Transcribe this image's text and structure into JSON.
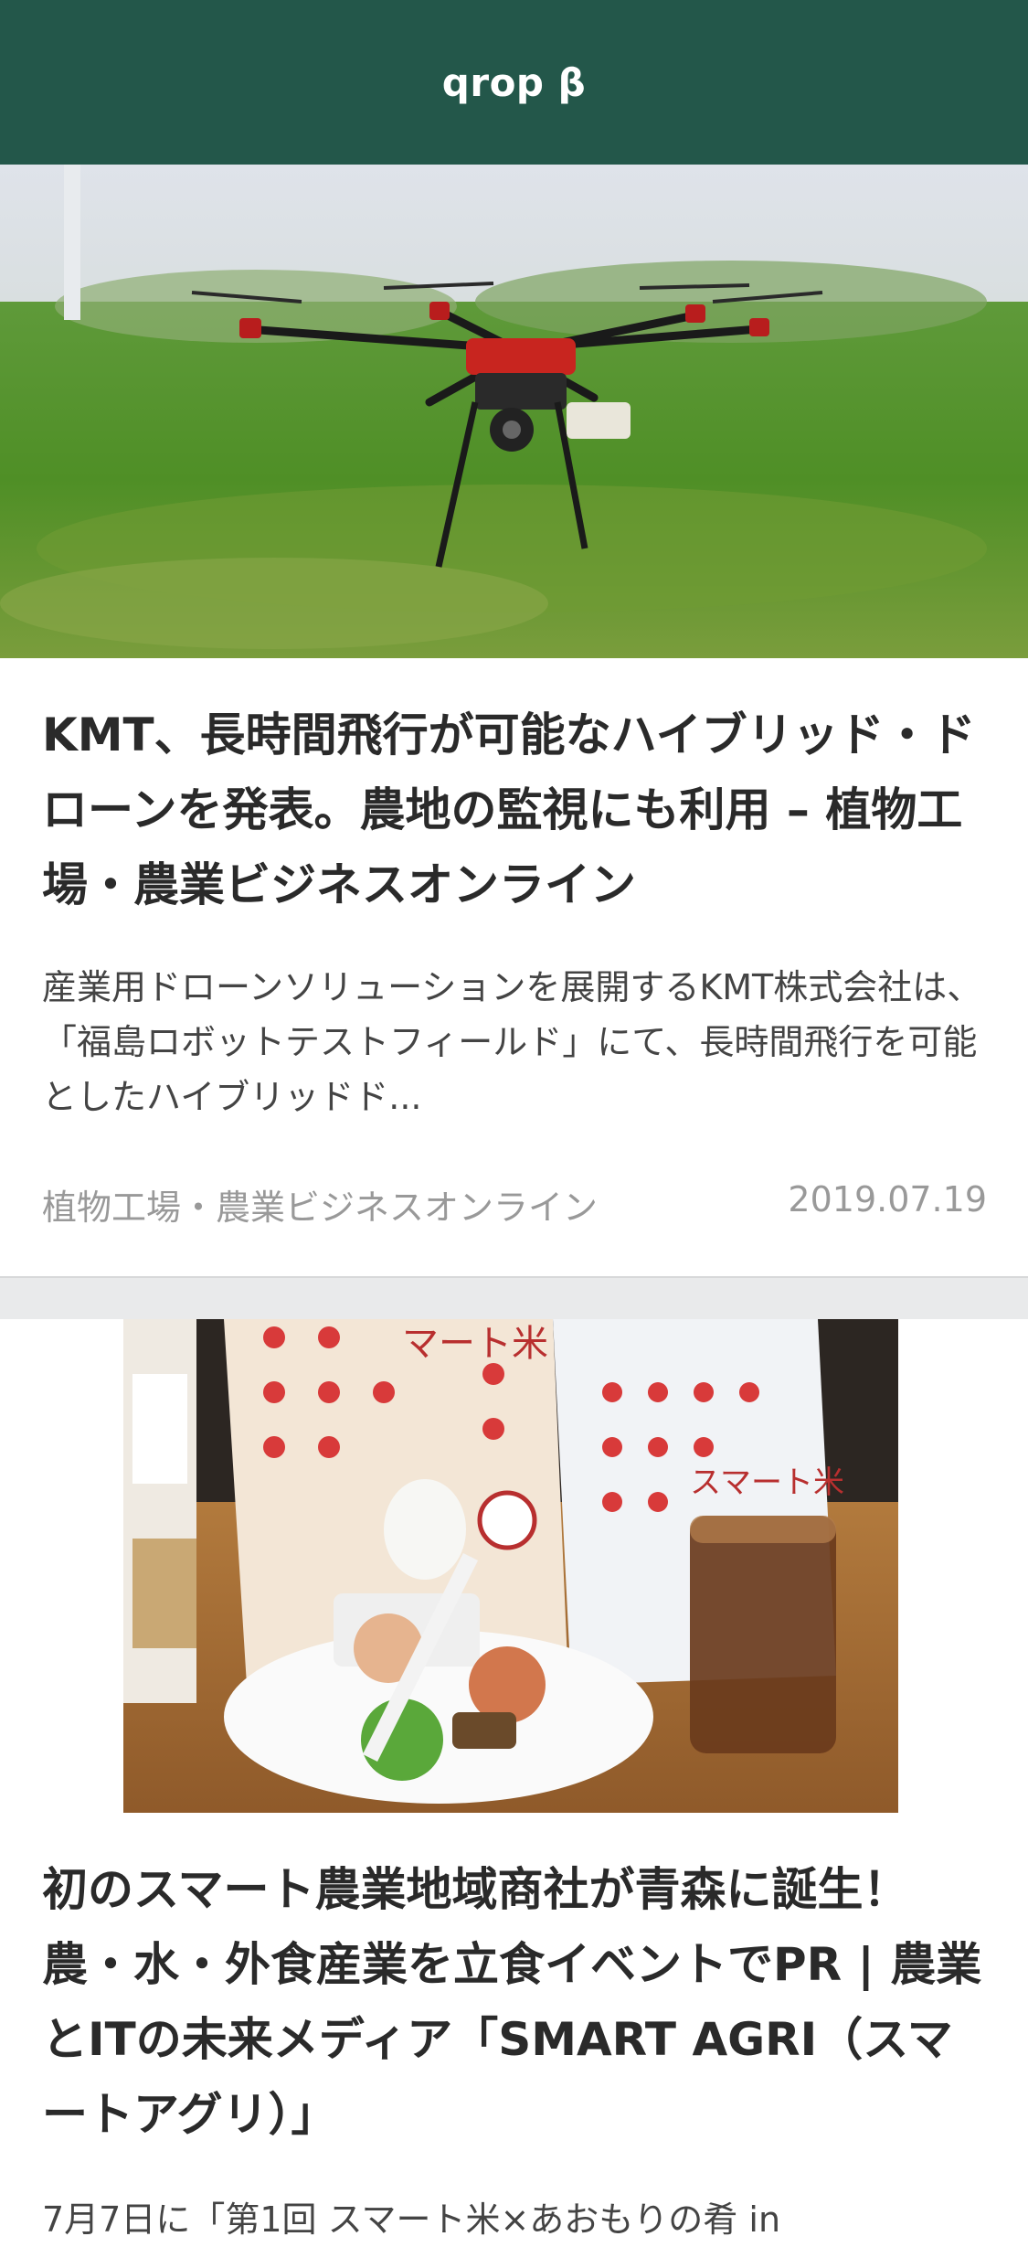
{
  "header": {
    "title": "qrop β"
  },
  "feed": [
    {
      "image_icon": "drone-photo",
      "title": "KMT、長時間飛行が可能なハイブリッド・ドローンを発表。農地の監視にも利用 – 植物工場・農業ビジネスオンライン",
      "summary": "産業用ドローンソリューションを展開するKMT株式会社は、「福島ロボットテストフィールド」にて、長時間飛行を可能としたハイブリッドド...",
      "source": "植物工場・農業ビジネスオンライン",
      "date": "2019.07.19"
    },
    {
      "image_icon": "rice-bags-photo",
      "title": "初のスマート農業地域商社が青森に誕生！ 農・水・外食産業を立食イベントでPR | 農業とITの未来メディア「SMART AGRI（スマートアグリ）」",
      "summary": "7月7日に「第1回 スマート米×あおもりの肴 in"
    }
  ],
  "colors": {
    "header_bg": "#23574a",
    "divider": "#e9eaeb"
  }
}
